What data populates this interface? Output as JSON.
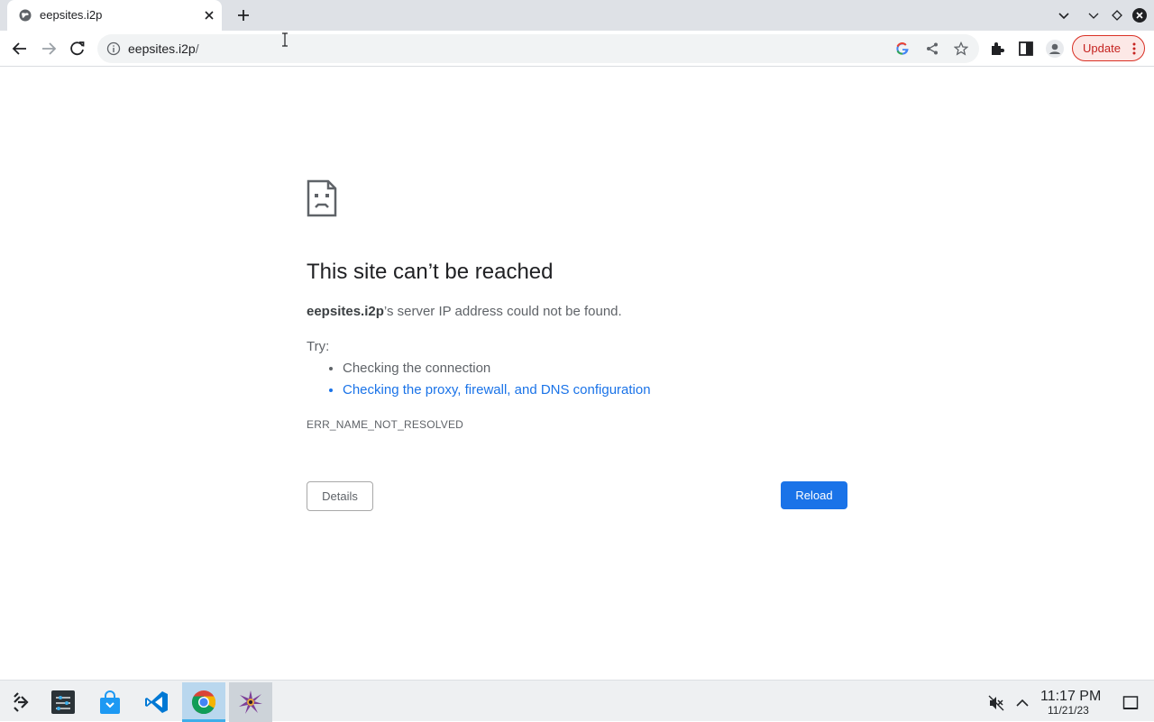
{
  "browser": {
    "tab": {
      "title": "eepsites.i2p"
    },
    "omnibox": {
      "host": "eepsites.i2p",
      "path": "/"
    },
    "update_label": "Update"
  },
  "error_page": {
    "heading": "This site can’t be reached",
    "host_bold": "eepsites.i2p",
    "desc_rest": "’s server IP address could not be found.",
    "try_label": "Try:",
    "suggestions": [
      "Checking the connection",
      "Checking the proxy, firewall, and DNS configuration"
    ],
    "error_code": "ERR_NAME_NOT_RESOLVED",
    "details_label": "Details",
    "reload_label": "Reload"
  },
  "taskbar": {
    "time": "11:17 PM",
    "date": "11/21/23",
    "apps": [
      "application-launcher-icon",
      "system-settings-icon",
      "software-store-icon",
      "vscode-icon",
      "chrome-icon",
      "spiky-app-icon"
    ]
  },
  "colors": {
    "accent": "#1a73e8",
    "update_border": "#d93025",
    "taskbar_active": "#b9d7ee"
  }
}
